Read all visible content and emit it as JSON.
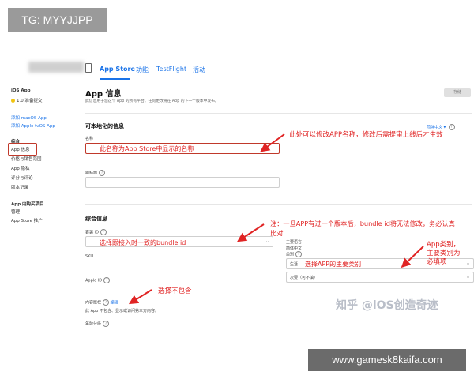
{
  "watermark_top": "TG: MYYJJPP",
  "watermark_bottom": "www.gamesk8kaifa.com",
  "watermark_zhihu": "知乎 @iOS创造奇迹",
  "nav": {
    "tabs": [
      "App Store",
      "功能",
      "TestFlight",
      "活动"
    ]
  },
  "sidebar": {
    "ios_app": "iOS App",
    "version": "1.0 准备提交",
    "add_macos": "添加 macOS App",
    "add_tvos": "添加 Apple tvOS App",
    "general_header": "综合",
    "items": [
      "App 信息",
      "价格与销售范围",
      "App 隐私",
      "评分与评论",
      "版本记录"
    ],
    "iap_header": "App 内购买项目",
    "iap_items": [
      "管理",
      "App Store 推广"
    ]
  },
  "main": {
    "title": "App 信息",
    "description": "此信息用于您这个 App 的所有平台。任何更改将在 App 的下一个版本中发布。",
    "save_button": "存储",
    "localizable_title": "可本地化的信息",
    "lang_select": "简体中文",
    "name_label": "名称",
    "subtitle_label": "副标题",
    "general_title": "综合信息",
    "bundle_label": "套装 ID",
    "sku_label": "SKU",
    "appleid_label": "Apple ID",
    "content_rights_label": "内容版权",
    "content_rights_edit": "编辑",
    "content_rights_text": "此 App 不包含、显示或访问第三方内容。",
    "age_label": "年龄分级",
    "primary_lang_label": "主要语言",
    "primary_lang_value": "简体中文",
    "category_label": "类别",
    "category_primary": "生活",
    "category_secondary": "次要（可不填）"
  },
  "annotations": {
    "name_field_text": "此名称为App Store中显示的名称",
    "name_note": "此处可以修改APP名称，修改后需提审上线后才生效",
    "bundle_field_text": "选择跟接入时一致的bundle id",
    "bundle_note": "注：一旦APP有过一个版本后，bundle id将无法修改，务必认真比对",
    "category_field_text": "选择APP的主要类别",
    "category_note_1": "App类别，",
    "category_note_2": "主要类别为",
    "category_note_3": "必填项",
    "content_note": "选择不包含"
  },
  "colors": {
    "link_blue": "#1a73e8",
    "annotation_red": "#e02424",
    "box_red": "#c0392b"
  }
}
